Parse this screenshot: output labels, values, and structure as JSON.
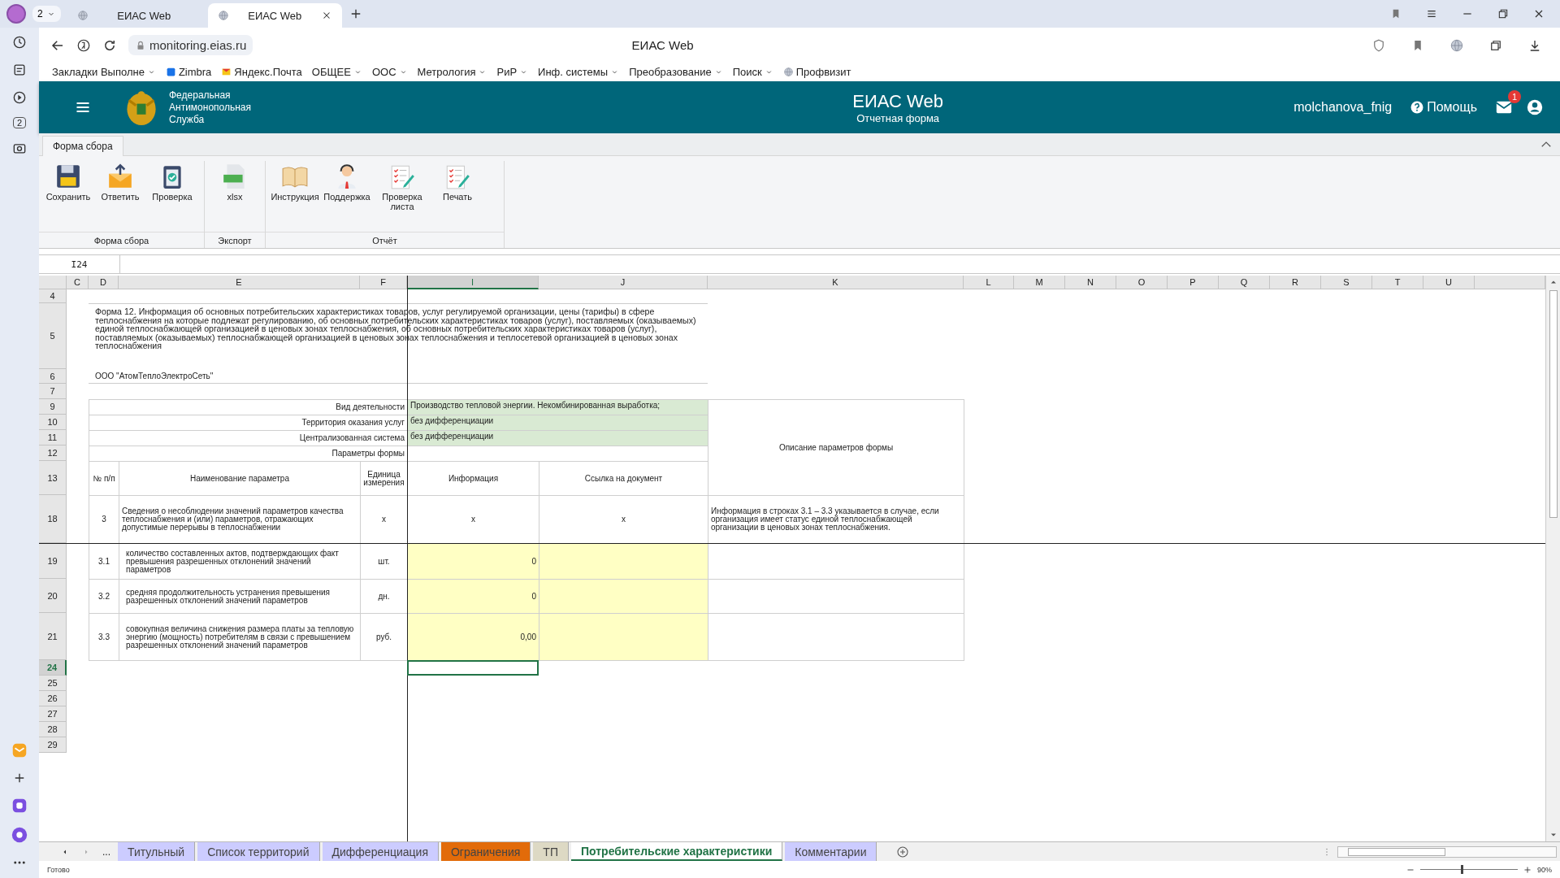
{
  "browser": {
    "tab_count": "2",
    "tabs": [
      {
        "title": "ЕИАС Web",
        "selected": false
      },
      {
        "title": "ЕИАС Web",
        "selected": true
      }
    ],
    "address": "monitoring.eias.ru",
    "page_title": "ЕИАС Web",
    "sidebar_badge": "2",
    "bookmarks": [
      {
        "label": "Закладки Выполне",
        "menu": true
      },
      {
        "label": "Zimbra",
        "menu": false
      },
      {
        "label": "Яндекс.Почта",
        "menu": false
      },
      {
        "label": "ОБЩЕЕ",
        "menu": true
      },
      {
        "label": "ООС",
        "menu": true
      },
      {
        "label": "Метрология",
        "menu": true
      },
      {
        "label": "РиР",
        "menu": true
      },
      {
        "label": "Инф. системы",
        "menu": true
      },
      {
        "label": "Преобразование",
        "menu": true
      },
      {
        "label": "Поиск",
        "menu": true
      },
      {
        "label": "Профвизит",
        "menu": false
      }
    ]
  },
  "app": {
    "org_name": "Федеральная Антимонопольная Служба",
    "title": "ЕИАС Web",
    "subtitle": "Отчетная форма",
    "user": "molchanova_fnig",
    "help": "Помощь",
    "mail_badge": "1"
  },
  "ribbon": {
    "tabs": [
      {
        "label": "Форма сбора",
        "selected": true
      }
    ],
    "groups": [
      {
        "label": "Форма сбора",
        "buttons": [
          "Сохранить",
          "Ответить",
          "Проверка"
        ]
      },
      {
        "label": "Экспорт",
        "buttons": [
          "xlsx"
        ]
      },
      {
        "label": "Отчёт",
        "buttons": [
          "Инструкция",
          "Поддержка",
          "Проверка листа",
          "Печать"
        ]
      }
    ]
  },
  "sheet": {
    "name_box": "I24",
    "columns": [
      {
        "label": "C",
        "selected": false
      },
      {
        "label": "D",
        "selected": false
      },
      {
        "label": "E",
        "selected": false
      },
      {
        "label": "F",
        "selected": false
      },
      {
        "label": "I",
        "selected": true
      },
      {
        "label": "J",
        "selected": false
      },
      {
        "label": "K",
        "selected": false
      },
      {
        "label": "L",
        "selected": false
      },
      {
        "label": "M",
        "selected": false
      },
      {
        "label": "N",
        "selected": false
      },
      {
        "label": "O",
        "selected": false
      },
      {
        "label": "P",
        "selected": false
      },
      {
        "label": "Q",
        "selected": false
      },
      {
        "label": "R",
        "selected": false
      },
      {
        "label": "S",
        "selected": false
      },
      {
        "label": "T",
        "selected": false
      },
      {
        "label": "U",
        "selected": false
      }
    ],
    "rows": [
      {
        "label": "4",
        "selected": false
      },
      {
        "label": "5",
        "selected": false
      },
      {
        "label": "6",
        "selected": false
      },
      {
        "label": "7",
        "selected": false
      },
      {
        "label": "9",
        "selected": false
      },
      {
        "label": "10",
        "selected": false
      },
      {
        "label": "11",
        "selected": false
      },
      {
        "label": "12",
        "selected": false
      },
      {
        "label": "13",
        "selected": false
      },
      {
        "label": "18",
        "selected": false
      },
      {
        "label": "19",
        "selected": false
      },
      {
        "label": "20",
        "selected": false
      },
      {
        "label": "21",
        "selected": false
      },
      {
        "label": "24",
        "selected": true
      },
      {
        "label": "25",
        "selected": false
      },
      {
        "label": "26",
        "selected": false
      },
      {
        "label": "27",
        "selected": false
      },
      {
        "label": "28",
        "selected": false
      },
      {
        "label": "29",
        "selected": false
      }
    ],
    "form_title": "Форма 12. Информация об основных потребительских характеристиках товаров, услуг регулируемой организации, цены (тарифы) в сфере теплоснабжения на которые подлежат регулированию, об основных потребительских характеристиках товаров (услуг), поставляемых (оказываемых) единой теплоснабжающей организацией в ценовых зонах теплоснабжения, об основных потребительских характеристиках товаров (услуг), поставляемых (оказываемых) теплоснабжающей организацией в ценовых зонах теплоснабжения и теплосетевой организацией в ценовых зонах теплоснабжения",
    "organization": "ООО \"АтомТеплоЭлектроСеть\"",
    "parameters": [
      {
        "label": "Вид деятельности",
        "value": "Производство тепловой энергии. Некомбинированная выработка;"
      },
      {
        "label": "Территория оказания услуг",
        "value": "без дифференциации"
      },
      {
        "label": "Централизованная система",
        "value": "без дифференциации"
      },
      {
        "label": "Параметры формы"
      }
    ],
    "parameters_note": "Описание параметров формы",
    "table_header": [
      "№ п/п",
      "Наименование параметра",
      "Единица измерения",
      "Информация",
      "Ссылка на документ"
    ],
    "table_rows": [
      {
        "kind": "section",
        "number": "3",
        "name": "Сведения о несоблюдении значений параметров качества теплоснабжения и (или) параметров, отражающих допустимые перерывы в теплоснабжении",
        "unit": "x",
        "info": "x",
        "link": "x",
        "note": "Информация в строках 3.1 – 3.3 указывается в случае, если организация имеет статус единой теплоснабжающей организации в ценовых зонах теплоснабжения."
      },
      {
        "kind": "input",
        "number": "3.1",
        "name": "количество составленных актов, подтверждающих факт превышения разрешенных отклонений значений параметров",
        "unit": "шт.",
        "info": "0"
      },
      {
        "kind": "input",
        "number": "3.2",
        "name": "средняя продолжительность устранения превышения разрешенных отклонений значений параметров",
        "unit": "дн.",
        "info": "0"
      },
      {
        "kind": "input",
        "number": "3.3",
        "name": "совокупная величина снижения размера платы за тепловую энергию (мощность) потребителям в связи с превышением разрешенных отклонений значений параметров",
        "unit": "руб.",
        "info": "0,00"
      }
    ],
    "more": "...",
    "tabs": [
      {
        "label": "Титульный",
        "color": "#ccccff",
        "selected": false
      },
      {
        "label": "Список территорий",
        "color": "#ccccff",
        "selected": false
      },
      {
        "label": "Дифференциация",
        "color": "#ccccff",
        "selected": false
      },
      {
        "label": "Ограничения",
        "color": "#e26b0a",
        "selected": false
      },
      {
        "label": "ТП",
        "color": "#ddd9c4",
        "selected": false
      },
      {
        "label": "Потребительские характеристики",
        "color": "#ffffff",
        "selected": true
      },
      {
        "label": "Комментарии",
        "color": "#ccccff",
        "selected": false
      }
    ]
  },
  "status_bar": {
    "status": "Готово",
    "zoom": "90%",
    "zoom_slider": {
      "level": 0.42
    }
  }
}
